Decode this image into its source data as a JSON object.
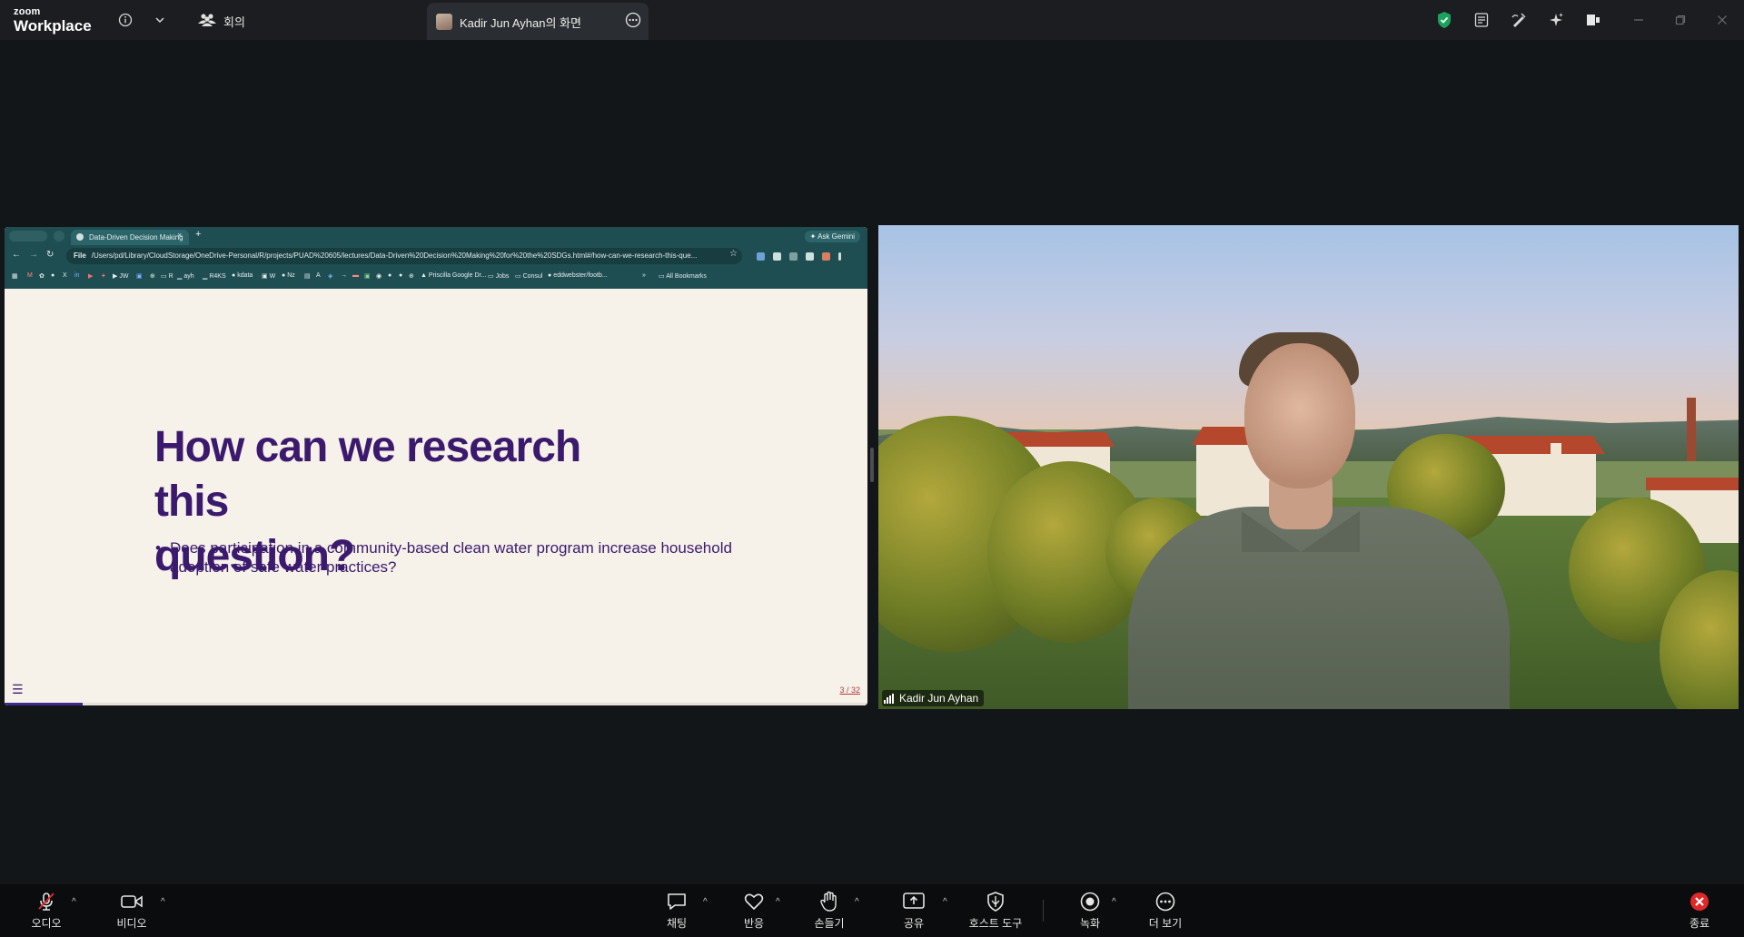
{
  "titlebar": {
    "logo_line1": "zoom",
    "logo_line2": "Workplace",
    "meeting_label": "회의",
    "share_tab_label": "Kadir Jun Ayhan의 화면",
    "icons": [
      "info-icon",
      "chevron-down-icon",
      "participants-icon",
      "more-icon",
      "shield-check-icon",
      "notes-icon",
      "whiteboard-icon",
      "ai-companion-icon",
      "apps-icon",
      "minimize-icon",
      "maximize-icon",
      "close-icon"
    ],
    "colors": {
      "security_green": "#1aa35c"
    }
  },
  "browser": {
    "tab_title": "Data-Driven Decision Making",
    "tab_close": "×",
    "new_tab": "+",
    "ask_gemini": "Ask Gemini",
    "url_scheme": "File",
    "url": "/Users/pd/Library/CloudStorage/OneDrive-Personal/R/projects/PUAD%20605/lectures/Data-Driven%20Decision%20Making%20for%20the%20SDGs.html#/how-can-we-research-this-que...",
    "bookmarks": [
      "R",
      "ayh",
      "R4KS",
      "kdata",
      "W",
      "Nz",
      "Priscilla Google Dr...",
      "Jobs",
      "Consul",
      "eddwebster/footb...",
      "»",
      "All Bookmarks"
    ]
  },
  "slide": {
    "title_line1": "How can we research this",
    "title_line2": "question?",
    "bullet": "Does participation in a community-based clean water program increase household adoption of safe water practices?",
    "page": "3 / 32",
    "progress": 0.09
  },
  "video": {
    "participant_name": "Kadir Jun Ayhan"
  },
  "toolbar": {
    "audio": "오디오",
    "video": "비디오",
    "chat": "채팅",
    "react": "반응",
    "raise_hand": "손들기",
    "share": "공유",
    "host_tools": "호스트 도구",
    "record": "녹화",
    "more": "더 보기",
    "end": "종료",
    "colors": {
      "end_red": "#e02828",
      "mute_red": "#e02828"
    }
  }
}
